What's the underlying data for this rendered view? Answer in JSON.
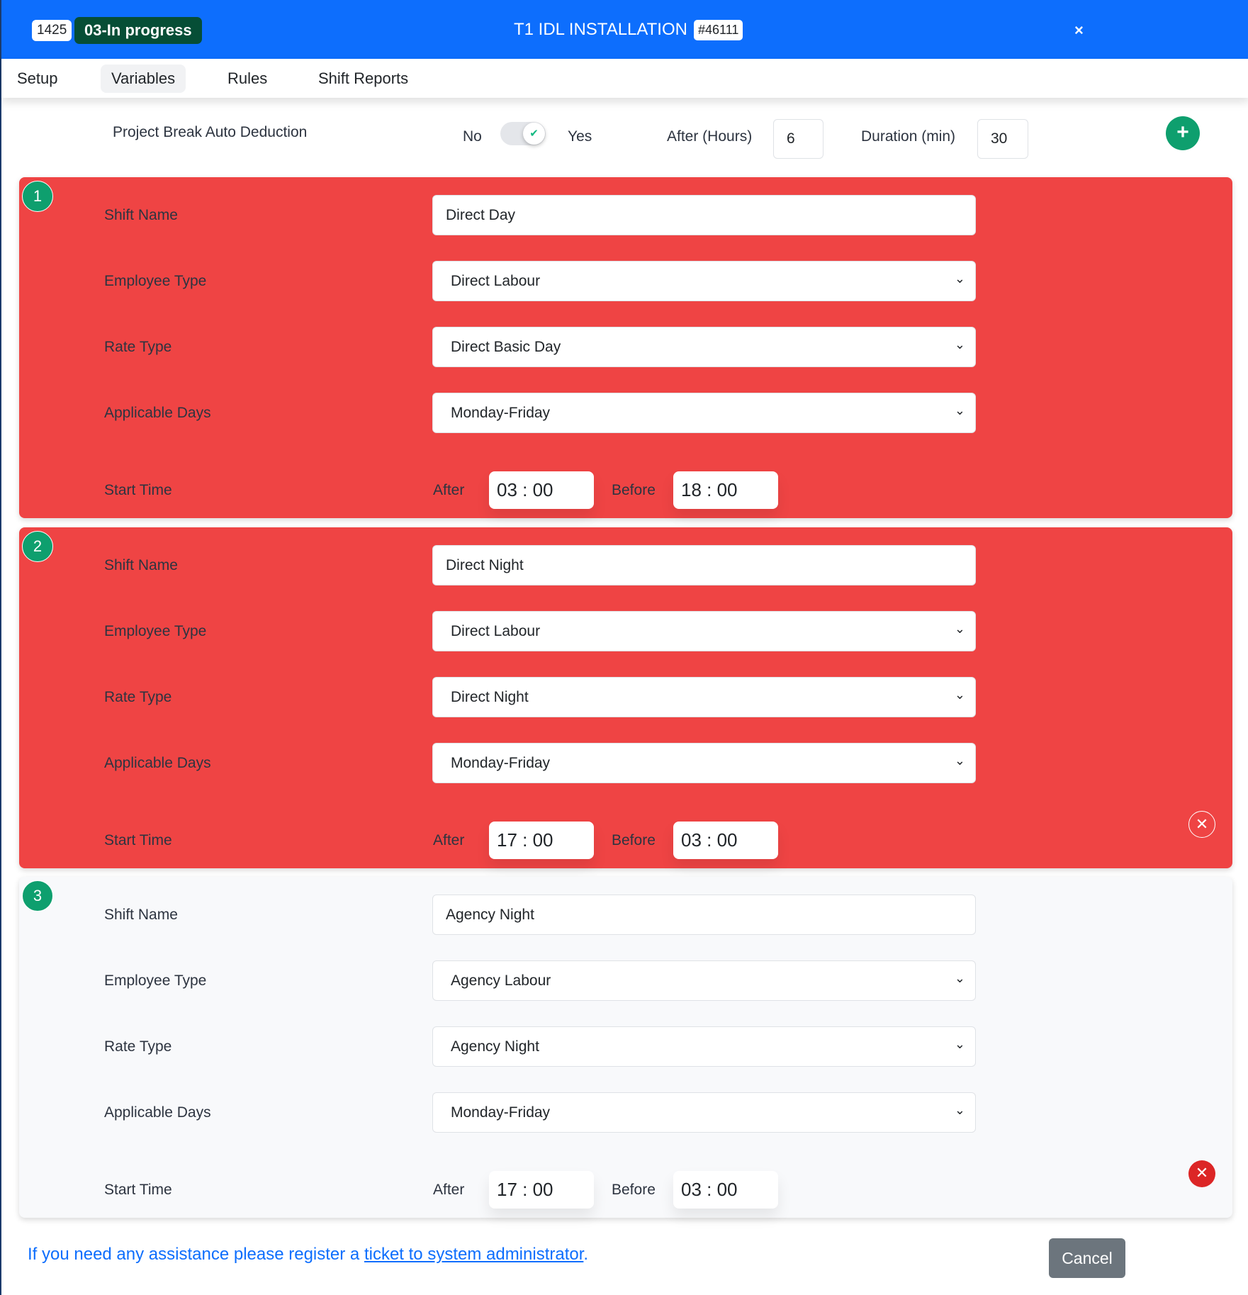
{
  "header": {
    "id": "1425",
    "status": "03-In progress",
    "title": "T1 IDL INSTALLATION",
    "number": "#46111",
    "close": "×"
  },
  "tabs": [
    "Setup",
    "Variables",
    "Rules",
    "Shift Reports"
  ],
  "break": {
    "label": "Project Break Auto Deduction",
    "no": "No",
    "yes": "Yes",
    "enabled": true,
    "after_label": "After (Hours)",
    "after_value": "6",
    "duration_label": "Duration (min)",
    "duration_value": "30"
  },
  "labels": {
    "shift_name": "Shift Name",
    "employee_type": "Employee Type",
    "rate_type": "Rate Type",
    "applicable_days": "Applicable Days",
    "start_time": "Start Time",
    "after": "After",
    "before": "Before"
  },
  "shifts": [
    {
      "n": "1",
      "name": "Direct Day",
      "employee_type": "Direct Labour",
      "rate_type": "Direct Basic Day",
      "days": "Monday-Friday",
      "after": "03 :  00",
      "before": "18 :  00"
    },
    {
      "n": "2",
      "name": "Direct Night",
      "employee_type": "Direct Labour",
      "rate_type": "Direct Night",
      "days": "Monday-Friday",
      "after": "17 :  00",
      "before": "03 :  00"
    },
    {
      "n": "3",
      "name": "Agency Night",
      "employee_type": "Agency Labour",
      "rate_type": "Agency Night",
      "days": "Monday-Friday",
      "after": "17 :  00",
      "before": "03 :  00"
    }
  ],
  "footer": {
    "text": "If you need any assistance please register a ",
    "link": "ticket to system administrator",
    "end": ".",
    "cancel": "Cancel"
  },
  "colors": {
    "header": "#0d6efd",
    "status": "#064e36",
    "error_card": "#ef4444",
    "badge": "#0e9f6e"
  }
}
